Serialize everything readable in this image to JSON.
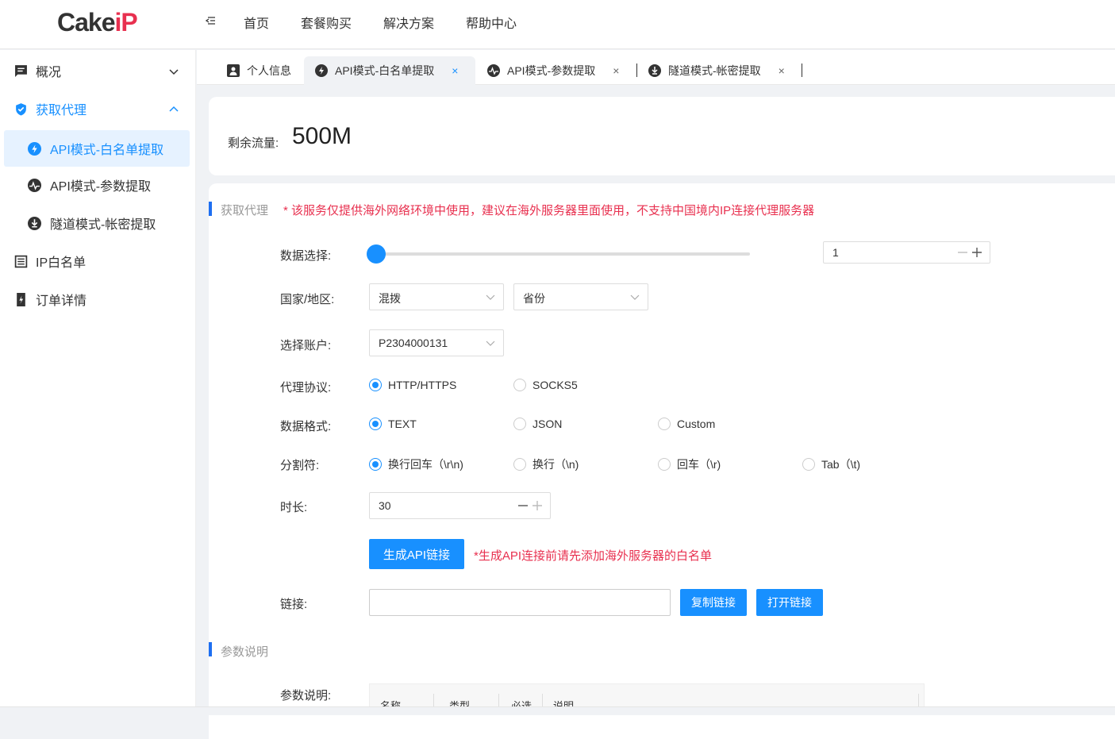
{
  "header": {
    "logo_main": "Cake",
    "logo_accent": "iP",
    "nav": [
      "首页",
      "套餐购买",
      "解决方案",
      "帮助中心"
    ]
  },
  "sidebar": {
    "items": [
      {
        "label": "概况",
        "icon": "chat-square-icon"
      },
      {
        "label": "获取代理",
        "icon": "shield-icon"
      },
      {
        "label": "API模式-白名单提取",
        "icon": "lightning-icon"
      },
      {
        "label": "API模式-参数提取",
        "icon": "pulse-icon"
      },
      {
        "label": "隧道模式-帐密提取",
        "icon": "download-circle-icon"
      },
      {
        "label": "IP白名单",
        "icon": "list-icon"
      },
      {
        "label": "订单详情",
        "icon": "bolt-doc-icon"
      }
    ]
  },
  "tabs": [
    {
      "label": "个人信息",
      "icon": "user-icon"
    },
    {
      "label": "API模式-白名单提取",
      "icon": "lightning-icon",
      "close": "×"
    },
    {
      "label": "API模式-参数提取",
      "icon": "pulse-icon",
      "close": "×"
    },
    {
      "label": "隧道模式-帐密提取",
      "icon": "download-circle-icon",
      "close": "×"
    }
  ],
  "traffic": {
    "label": "剩余流量:",
    "value": "500M"
  },
  "section1": {
    "title": "获取代理",
    "warning": "* 该服务仅提供海外网络环境中使用，建议在海外服务器里面使用，不支持中国境内IP连接代理服务器"
  },
  "form": {
    "data_select_label": "数据选择:",
    "data_select_value": "1",
    "region_label": "国家/地区:",
    "region_value": "混拨",
    "province_value": "省份",
    "account_label": "选择账户:",
    "account_value": "P2304000131",
    "protocol_label": "代理协议:",
    "protocols": [
      "HTTP/HTTPS",
      "SOCKS5"
    ],
    "format_label": "数据格式:",
    "formats": [
      "TEXT",
      "JSON",
      "Custom"
    ],
    "separator_label": "分割符:",
    "separators": [
      "换行回车（\\r\\n)",
      "换行（\\n)",
      "回车（\\r)",
      "Tab（\\t)"
    ],
    "duration_label": "时长:",
    "duration_value": "30",
    "generate_button": "生成API链接",
    "generate_note": "*生成API连接前请先添加海外服务器的白名单",
    "link_label": "链接:",
    "link_value": "",
    "copy_button": "复制链接",
    "open_button": "打开链接"
  },
  "section2": {
    "title": "参数说明",
    "label": "参数说明:",
    "columns": [
      "名称",
      "类型",
      "必选",
      "说明"
    ]
  },
  "colors": {
    "accent": "#1890ff",
    "warning": "#e8304f",
    "brand": "#e8304f"
  }
}
